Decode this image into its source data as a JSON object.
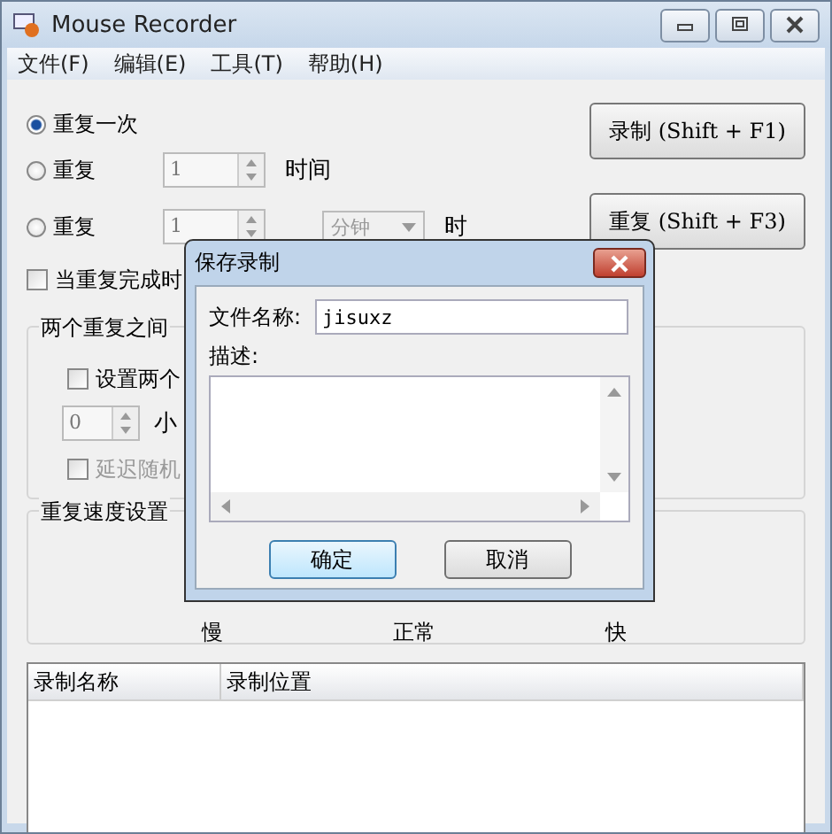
{
  "window": {
    "title": "Mouse Recorder"
  },
  "menu": [
    "文件(F)",
    "编辑(E)",
    "工具(T)",
    "帮助(H)"
  ],
  "repeat_options": [
    {
      "kind": "once",
      "label": "重复一次",
      "selected": true
    },
    {
      "kind": "count",
      "label": "重复",
      "value": "1",
      "unit": "时间",
      "selected": false
    },
    {
      "kind": "interval",
      "label": "重复",
      "value": "1",
      "dropdown": "分钟",
      "unit": "时",
      "selected": false
    }
  ],
  "actions": [
    "录制 (Shift + F1)",
    "重复 (Shift + F3)"
  ],
  "on_complete": {
    "label": "当重复完成时",
    "checked": false
  },
  "delay_group": {
    "title": "两个重复之间",
    "set_delay": {
      "label": "设置两个",
      "checked": false
    },
    "hours": {
      "value": "0",
      "unit": "小"
    },
    "random_delay": {
      "label": "延迟随机",
      "checked": false,
      "disabled": true
    }
  },
  "speed_group": {
    "title": "重复速度设置",
    "labels": [
      "慢",
      "正常",
      "快"
    ]
  },
  "list": {
    "columns": [
      "录制名称",
      "录制位置"
    ]
  },
  "dialog": {
    "title": "保存录制",
    "file_name_label": "文件名称:",
    "file_name": "jisuxz",
    "description_label": "描述:",
    "buttons": [
      {
        "label": "确定",
        "default": true
      },
      {
        "label": "取消",
        "default": false
      }
    ]
  }
}
